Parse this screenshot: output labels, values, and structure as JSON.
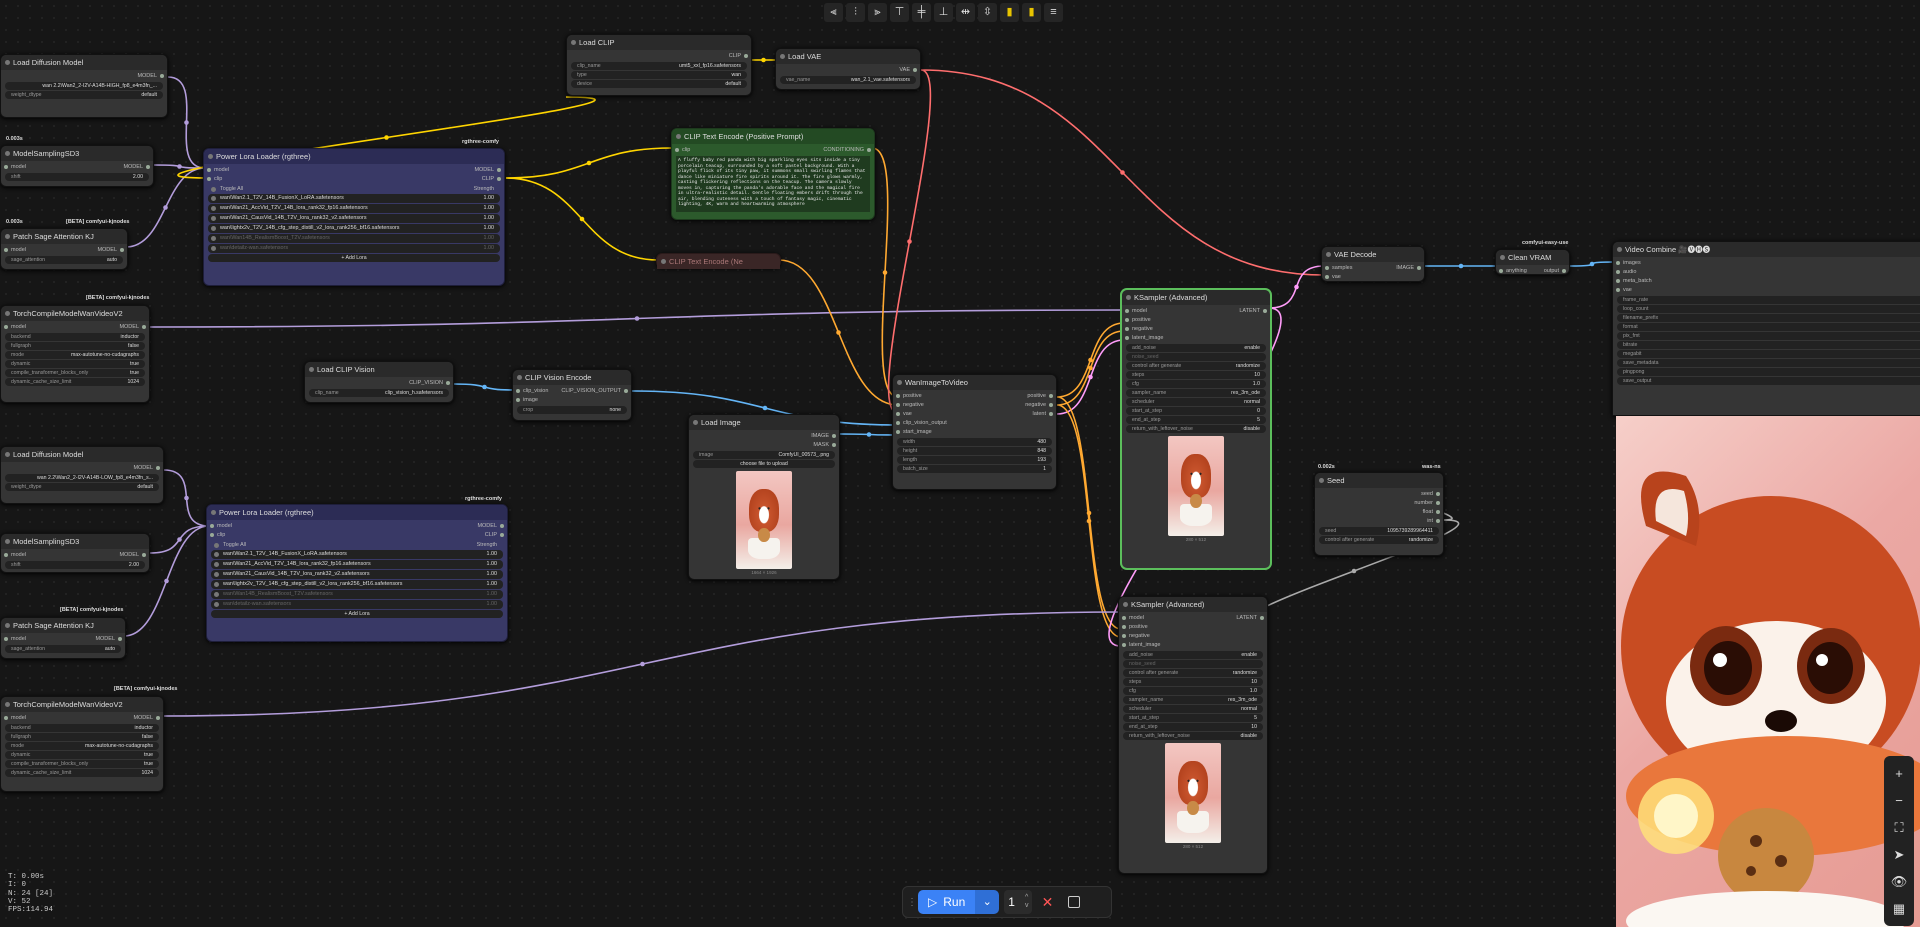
{
  "toolbar": {
    "icons": [
      "align-left-icon",
      "align-center-icon",
      "align-right-icon",
      "align-top-icon",
      "align-middle-icon",
      "align-bottom-icon",
      "distribute-h-icon",
      "distribute-v-icon",
      "color-icon",
      "pin-icon",
      "menu-icon"
    ],
    "glyphs": [
      "⫷",
      "⫶",
      "⫸",
      "⊤",
      "╪",
      "⊥",
      "⇹",
      "⇳",
      "▮",
      "▮",
      "≡"
    ]
  },
  "nodes": {
    "load_diff_1": {
      "title": "Load Diffusion Model",
      "out": "MODEL",
      "w1_label": "",
      "w1_val": "wan 2.2\\Wan2_2-I2V-A14B-HIGH_fp8_e4m3fn_...",
      "w2_label": "weight_dtype",
      "w2_val": "default"
    },
    "model_samp_1": {
      "title": "ModelSamplingSD3",
      "time": "0.003s",
      "in": "model",
      "out": "MODEL",
      "w_label": "shift",
      "w_val": "2.00"
    },
    "patch_sage_1": {
      "title": "Patch Sage Attention KJ",
      "time": "0.003s",
      "badge": "[BETA] comfyui-kjnodes",
      "in": "model",
      "out": "MODEL",
      "w_label": "sage_attention",
      "w_val": "auto"
    },
    "torch_compile_1": {
      "title": "TorchCompileModelWanVideoV2",
      "time": "0s",
      "badge": "[BETA] comfyui-kjnodes",
      "in": "model",
      "out": "MODEL",
      "rows": [
        [
          "backend",
          "inductor"
        ],
        [
          "fullgraph",
          "false"
        ],
        [
          "mode",
          "max-autotune-no-cudagraphs"
        ],
        [
          "dynamic",
          "true"
        ],
        [
          "compile_transformer_blocks_only",
          "true"
        ],
        [
          "dynamic_cache_size_limit",
          "1024"
        ]
      ]
    },
    "lora_1": {
      "title": "Power Lora Loader (rgthree)",
      "badge": "rgthree-comfy",
      "in1": "model",
      "in2": "clip",
      "out1": "MODEL",
      "out2": "CLIP",
      "toggle": "Toggle All",
      "strength": "Strength",
      "loras": [
        [
          "wan\\Wan2.1_T2V_14B_FusionX_LoRA.safetensors",
          "1.00",
          true
        ],
        [
          "wan\\Wan21_AccVid_T2V_14B_lora_rank32_fp16.safetensors",
          "1.00",
          true
        ],
        [
          "wan\\Wan21_CausVid_14B_T2V_lora_rank32_v2.safetensors",
          "1.00",
          true
        ],
        [
          "wan\\lightx2v_T2V_14B_cfg_step_distill_v2_lora_rank256_bf16.safetensors",
          "1.00",
          true
        ],
        [
          "wan\\Wan14B_RealismBoost_T2V.safetensors",
          "1.00",
          false
        ],
        [
          "wan\\detailz-wan.safetensors",
          "1.00",
          false
        ]
      ],
      "add": "+ Add Lora"
    },
    "load_clip": {
      "title": "Load CLIP",
      "out": "CLIP",
      "rows": [
        [
          "clip_name",
          "umt5_xxl_fp16.safetensors"
        ],
        [
          "type",
          "wan"
        ],
        [
          "device",
          "default"
        ]
      ]
    },
    "load_vae": {
      "title": "Load VAE",
      "out": "VAE",
      "rows": [
        [
          "vae_name",
          "wan_2.1_vae.safetensors"
        ]
      ]
    },
    "clip_pos": {
      "title": "CLIP Text Encode (Positive Prompt)",
      "in": "clip",
      "out": "CONDITIONING",
      "text": "A fluffy baby red panda with big sparkling eyes sits inside a tiny porcelain teacup, surrounded by a soft pastel background. With a playful flick of its tiny paw, it summons small swirling flames that dance like miniature fire spirits around it. The fire glows warmly, casting flickering reflections on the teacup. The camera slowly moves in, capturing the panda's adorable face and the magical fire in ultra-realistic detail. Gentle floating embers drift through the air, blending cuteness with a touch of fantasy magic, cinematic lighting, 4K, warm and heartwarming atmosphere"
    },
    "clip_neg": {
      "title": "CLIP Text Encode (Ne"
    },
    "load_clip_vision": {
      "title": "Load CLIP Vision",
      "out": "CLIP_VISION",
      "rows": [
        [
          "clip_name",
          "clip_vision_h.safetensors"
        ]
      ]
    },
    "clip_vision_enc": {
      "title": "CLIP Vision Encode",
      "in1": "clip_vision",
      "in2": "image",
      "out": "CLIP_VISION_OUTPUT",
      "rows": [
        [
          "crop",
          "none"
        ]
      ]
    },
    "load_image": {
      "title": "Load Image",
      "out1": "IMAGE",
      "out2": "MASK",
      "rows": [
        [
          "image",
          "ComfyUI_00573_.png"
        ]
      ],
      "upload": "choose file to upload",
      "size": "1664 × 1926"
    },
    "wan_i2v": {
      "title": "WanImageToVideo",
      "ins": [
        "positive",
        "negative",
        "vae",
        "clip_vision_output",
        "start_image"
      ],
      "outs": [
        "positive",
        "negative",
        "latent"
      ],
      "rows": [
        [
          "width",
          "480"
        ],
        [
          "height",
          "848"
        ],
        [
          "length",
          "193"
        ],
        [
          "batch_size",
          "1"
        ]
      ]
    },
    "ks1": {
      "title": "KSampler (Advanced)",
      "ins": [
        "model",
        "positive",
        "negative",
        "latent_image"
      ],
      "out": "LATENT",
      "rows": [
        [
          "add_noise",
          "enable"
        ],
        [
          "noise_seed",
          ""
        ],
        [
          "control after generate",
          "randomize"
        ],
        [
          "steps",
          "10"
        ],
        [
          "cfg",
          "1.0"
        ],
        [
          "sampler_name",
          "res_3m_ode"
        ],
        [
          "scheduler",
          "normal"
        ],
        [
          "start_at_step",
          "0"
        ],
        [
          "end_at_step",
          "5"
        ],
        [
          "return_with_leftover_noise",
          "disable"
        ]
      ],
      "size": "280 × 512"
    },
    "ks2": {
      "title": "KSampler (Advanced)",
      "ins": [
        "model",
        "positive",
        "negative",
        "latent_image"
      ],
      "out": "LATENT",
      "rows": [
        [
          "add_noise",
          "enable"
        ],
        [
          "noise_seed",
          ""
        ],
        [
          "control after generate",
          "randomize"
        ],
        [
          "steps",
          "10"
        ],
        [
          "cfg",
          "1.0"
        ],
        [
          "sampler_name",
          "res_3m_ode"
        ],
        [
          "scheduler",
          "normal"
        ],
        [
          "start_at_step",
          "5"
        ],
        [
          "end_at_step",
          "10"
        ],
        [
          "return_with_leftover_noise",
          "disable"
        ]
      ],
      "size": "280 × 512"
    },
    "vae_decode": {
      "title": "VAE Decode",
      "in1": "samples",
      "in2": "vae",
      "out": "IMAGE"
    },
    "clean_vram": {
      "title": "Clean VRAM",
      "badge": "comfyui-easy-use",
      "in": "anything",
      "out": "output"
    },
    "seed": {
      "title": "Seed",
      "time": "0.002s",
      "badge": "was-ns",
      "outs": [
        "seed",
        "number",
        "float",
        "int"
      ],
      "rows": [
        [
          "seed",
          "1095739289964411"
        ],
        [
          "control after generate",
          "randomize"
        ]
      ]
    },
    "video_combine": {
      "title": "Video Combine 🎥🅥🅗🅢",
      "ins": [
        "images",
        "audio",
        "meta_batch",
        "vae"
      ],
      "rows": [
        "frame_rate",
        "loop_count",
        "filename_prefix",
        "format",
        "pix_fmt",
        "bitrate",
        "megabit",
        "save_metadata",
        "pingpong",
        "save_output"
      ]
    },
    "load_diff_2": {
      "title": "Load Diffusion Model",
      "out": "MODEL",
      "w1_val": "wan 2.2\\Wan2_2-I2V-A14B-LOW_fp8_e4m3fn_s...",
      "w2_label": "weight_dtype",
      "w2_val": "default"
    },
    "model_samp_2": {
      "title": "ModelSamplingSD3",
      "in": "model",
      "out": "MODEL",
      "w_label": "shift",
      "w_val": "2.00"
    },
    "patch_sage_2": {
      "title": "Patch Sage Attention KJ",
      "badge": "[BETA] comfyui-kjnodes",
      "in": "model",
      "out": "MODEL",
      "w_label": "sage_attention",
      "w_val": "auto"
    },
    "torch_compile_2": {
      "title": "TorchCompileModelWanVideoV2",
      "badge": "[BETA] comfyui-kjnodes",
      "in": "model",
      "out": "MODEL",
      "rows": [
        [
          "backend",
          "inductor"
        ],
        [
          "fullgraph",
          "false"
        ],
        [
          "mode",
          "max-autotune-no-cudagraphs"
        ],
        [
          "dynamic",
          "true"
        ],
        [
          "compile_transformer_blocks_only",
          "true"
        ],
        [
          "dynamic_cache_size_limit",
          "1024"
        ]
      ]
    },
    "lora_2": {
      "title": "Power Lora Loader (rgthree)",
      "badge": "rgthree-comfy",
      "in1": "model",
      "in2": "clip",
      "out1": "MODEL",
      "out2": "CLIP",
      "toggle": "Toggle All",
      "strength": "Strength",
      "loras": [
        [
          "wan\\Wan2.1_T2V_14B_FusionX_LoRA.safetensors",
          "1.00",
          true
        ],
        [
          "wan\\Wan21_AccVid_T2V_14B_lora_rank32_fp16.safetensors",
          "1.00",
          true
        ],
        [
          "wan\\Wan21_CausVid_14B_T2V_lora_rank32_v2.safetensors",
          "1.00",
          true
        ],
        [
          "wan\\lightx2v_T2V_14B_cfg_step_distill_v2_lora_rank256_bf16.safetensors",
          "1.00",
          true
        ],
        [
          "wan\\Wan14B_RealismBoost_T2V.safetensors",
          "1.00",
          false
        ],
        [
          "wan\\detailz-wan.safetensors",
          "1.00",
          false
        ]
      ],
      "add": "+ Add Lora"
    }
  },
  "stats": {
    "t": "T: 0.00s",
    "i": "I: 0",
    "n": "N: 24 [24]",
    "v": "V: 52",
    "fps": "FPS:114.94"
  },
  "runbar": {
    "run_label": "Run",
    "qty": "1",
    "up": "^",
    "down": "v"
  },
  "right_tools": [
    "+",
    "−",
    "⛶",
    "➤",
    "👁",
    "▦"
  ],
  "colors": {
    "model": "#b39ddb",
    "clip": "#ffd500",
    "conditioning": "#ffa931",
    "vae": "#ff6e6e",
    "image": "#64b5f6",
    "latent": "#ff9cf9",
    "selected": "#5cbf5c"
  }
}
